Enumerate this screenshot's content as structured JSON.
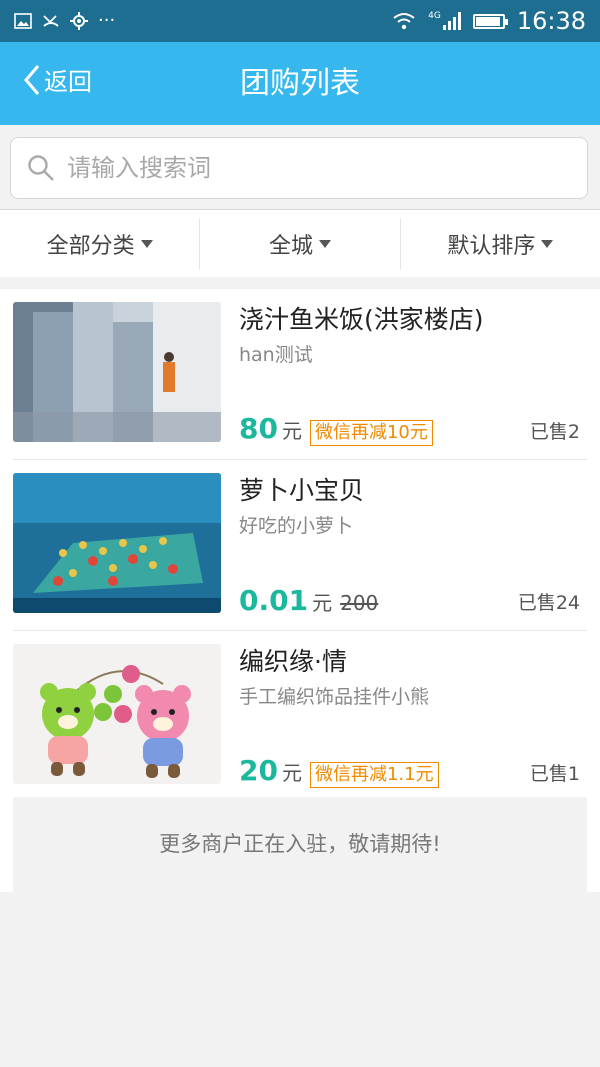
{
  "status_bar": {
    "time": "16:38",
    "network": "4G",
    "icons": [
      "image-icon",
      "missed-call-icon",
      "settings-icon",
      "more-icon",
      "wifi-icon",
      "signal-icon",
      "battery-icon"
    ]
  },
  "header": {
    "back_label": "返回",
    "title": "团购列表"
  },
  "search": {
    "placeholder": "请输入搜索词"
  },
  "filters": [
    {
      "label": "全部分类"
    },
    {
      "label": "全城"
    },
    {
      "label": "默认排序"
    }
  ],
  "items": [
    {
      "name": "浇汁鱼米饭(洪家楼店)",
      "desc": "han测试",
      "price": "80",
      "unit": "元",
      "tag": "微信再减10元",
      "sold": "已售2"
    },
    {
      "name": "萝卜小宝贝",
      "desc": "好吃的小萝卜",
      "price": "0.01",
      "unit": "元",
      "old_price": "200",
      "sold": "已售24"
    },
    {
      "name": "编织缘·情",
      "desc": "手工编织饰品挂件小熊",
      "price": "20",
      "unit": "元",
      "tag": "微信再减1.1元",
      "sold": "已售1"
    }
  ],
  "footer_text": "更多商户正在入驻，敬请期待!",
  "colors": {
    "status_bar": "#1e6e92",
    "header": "#36b8ef",
    "price": "#1cb89d",
    "tag": "#f08a00"
  }
}
